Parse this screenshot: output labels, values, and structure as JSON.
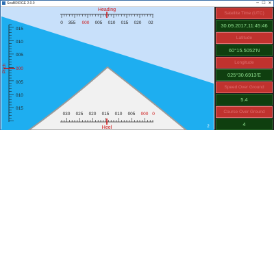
{
  "window": {
    "title": "SeaBRIDGE 2.0.0",
    "minimize": "─",
    "maximize": "☐",
    "close": "✕"
  },
  "heading": {
    "label": "Heading",
    "ticks": [
      "0",
      "355",
      "000",
      "005",
      "010",
      "015",
      "020",
      "02"
    ]
  },
  "pitch": {
    "label": "Pitch",
    "ticks": [
      "015",
      "010",
      "005",
      "000",
      "005",
      "010",
      "015"
    ]
  },
  "heel": {
    "label": "Heel",
    "ticks": [
      "030",
      "025",
      "020",
      "015",
      "010",
      "005",
      "000",
      "0"
    ]
  },
  "corner_mark": "2",
  "panel": {
    "items": [
      {
        "label": "Satellite Time (UTC)",
        "value": "30.09.2017,11:45:46"
      },
      {
        "label": "Latitude",
        "value": "60°15.5052'N"
      },
      {
        "label": "Longitude",
        "value": "025°30.6913'E"
      },
      {
        "label": "Speed Over Ground",
        "value": "5.4"
      },
      {
        "label": "Course Over Ground",
        "value": "4"
      }
    ]
  },
  "colors": {
    "sky": "#c8e0fa",
    "sea": "#1eaef0",
    "boat_fill": "#f1f1f1",
    "boat_stroke": "#9a9a9a",
    "accent_red": "#cc1111",
    "label_bg": "#c0322e",
    "value_bg": "#0f3f0f",
    "value_text": "#8fe08f"
  }
}
